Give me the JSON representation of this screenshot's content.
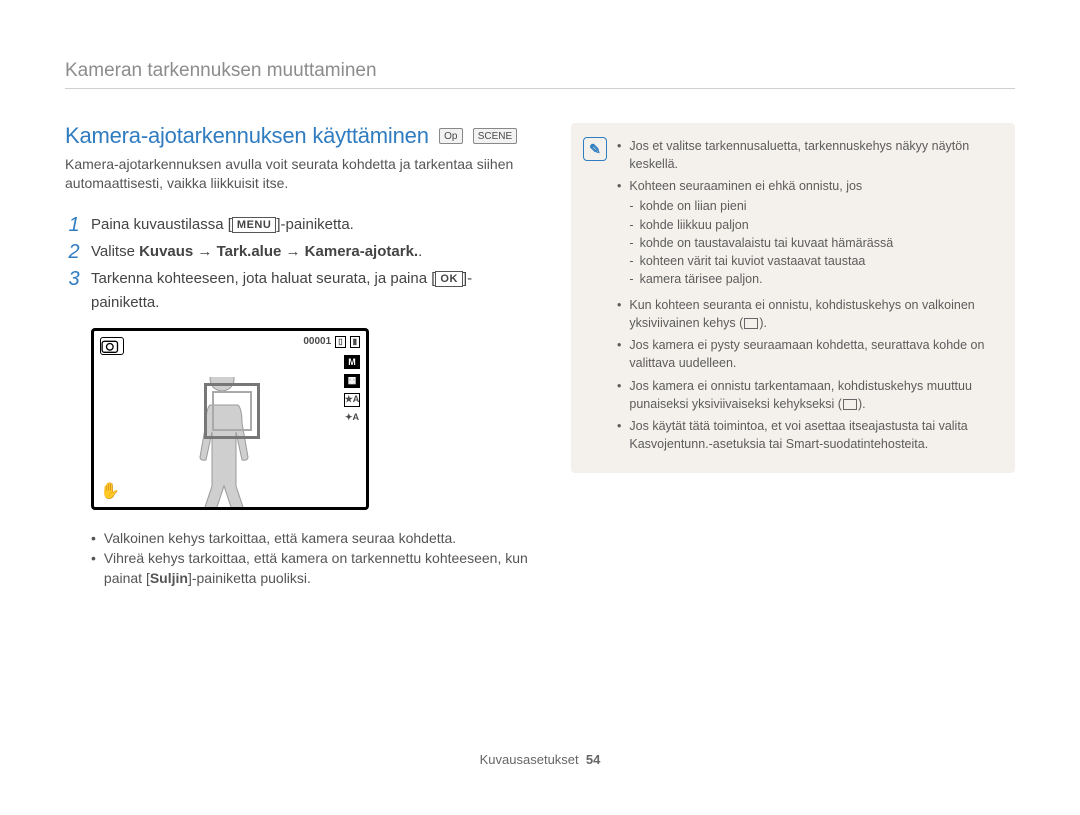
{
  "header": "Kameran tarkennuksen muuttaminen",
  "title": "Kamera-ajotarkennuksen käyttäminen",
  "mode_icons": [
    "Op",
    "SCENE"
  ],
  "intro": "Kamera-ajotarkennuksen avulla voit seurata kohdetta ja tarkentaa siihen automaattisesti, vaikka liikkuisit itse.",
  "steps": [
    {
      "n": "1",
      "pre": "Paina kuvaustilassa [",
      "btn": "MENU",
      "post": "]-painiketta."
    },
    {
      "n": "2",
      "pre": "Valitse ",
      "bold": "Kuvaus → Tark.alue → Kamera-ajotark.",
      "post": "."
    },
    {
      "n": "3",
      "pre": "Tarkenna kohteeseen, jota haluat seurata, ja paina [",
      "btn": "OK",
      "post": "]-painiketta."
    }
  ],
  "screen": {
    "counter": "00001",
    "right_icons": [
      "M",
      "▦",
      "★A",
      "✦A"
    ]
  },
  "left_bullets": [
    "Valkoinen kehys tarkoittaa, että kamera seuraa kohdetta.",
    [
      "Vihreä kehys tarkoittaa, että kamera on tarkennettu kohteeseen, kun painat [",
      "Suljin",
      "]-painiketta puoliksi."
    ]
  ],
  "notes": {
    "items": [
      {
        "text": "Jos et valitse tarkennusaluetta, tarkennuskehys näkyy näytön keskellä."
      },
      {
        "text": "Kohteen seuraaminen ei ehkä onnistu, jos",
        "sub": [
          "kohde on liian pieni",
          "kohde liikkuu paljon",
          "kohde on taustavalaistu tai kuvaat hämärässä",
          "kohteen värit tai kuviot vastaavat taustaa",
          "kamera tärisee paljon."
        ]
      },
      {
        "text_parts": [
          "Kun kohteen seuranta ei onnistu, kohdistuskehys on valkoinen yksiviivainen kehys (",
          "SQ",
          ")."
        ]
      },
      {
        "text": "Jos kamera ei pysty seuraamaan kohdetta, seurattava kohde on valittava uudelleen."
      },
      {
        "text_parts": [
          "Jos kamera ei onnistu tarkentamaan, kohdistuskehys muuttuu punaiseksi yksiviivaiseksi kehykseksi (",
          "SQ",
          ")."
        ]
      },
      {
        "text": "Jos käytät tätä toimintoa, et voi asettaa itseajastusta tai valita Kasvojentunn.-asetuksia tai Smart-suodatintehosteita."
      }
    ]
  },
  "footer": {
    "section": "Kuvausasetukset",
    "page": "54"
  }
}
